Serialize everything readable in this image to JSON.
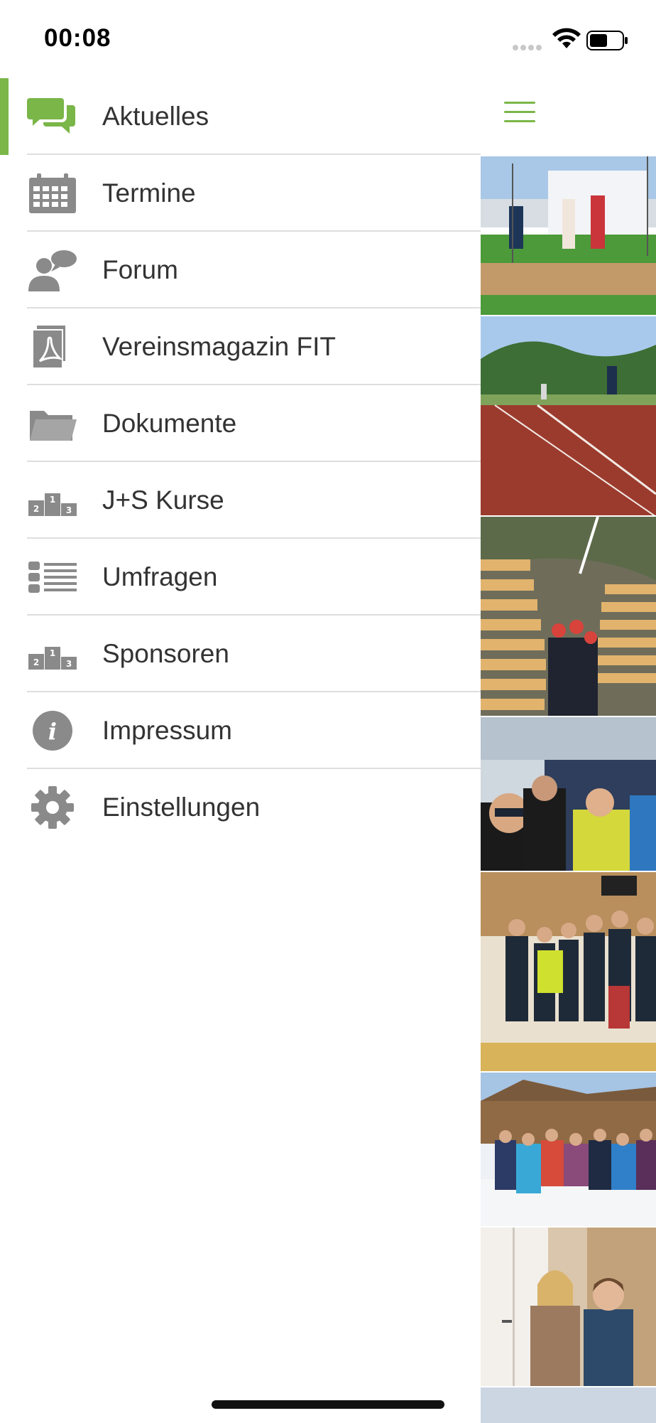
{
  "status": {
    "time": "00:08",
    "icons": [
      "signal-icon",
      "wifi-icon",
      "battery-icon"
    ]
  },
  "theme": {
    "accent": "#7ab648",
    "icon_gray": "#8a8a8a",
    "text": "#333333"
  },
  "menu": {
    "items": [
      {
        "label": "Aktuelles",
        "icon": "chat-bubbles-icon",
        "active": true
      },
      {
        "label": "Termine",
        "icon": "calendar-icon",
        "active": false
      },
      {
        "label": "Forum",
        "icon": "forum-person-icon",
        "active": false
      },
      {
        "label": "Vereinsmagazin FIT",
        "icon": "pdf-document-icon",
        "active": false
      },
      {
        "label": "Dokumente",
        "icon": "folder-icon",
        "active": false
      },
      {
        "label": "J+S Kurse",
        "icon": "podium-icon",
        "active": false
      },
      {
        "label": "Umfragen",
        "icon": "list-icon",
        "active": false
      },
      {
        "label": "Sponsoren",
        "icon": "podium-icon",
        "active": false
      },
      {
        "label": "Impressum",
        "icon": "info-icon",
        "active": false
      },
      {
        "label": "Einstellungen",
        "icon": "gear-icon",
        "active": false
      }
    ]
  },
  "header": {
    "menu_button_icon": "hamburger-icon"
  },
  "photos": [
    "athletics-podium-photo",
    "running-track-photo",
    "cheese-cellar-photo",
    "ski-group-selfie-photo",
    "youth-team-medals-photo",
    "ski-group-chalet-photo",
    "two-women-award-photo"
  ]
}
